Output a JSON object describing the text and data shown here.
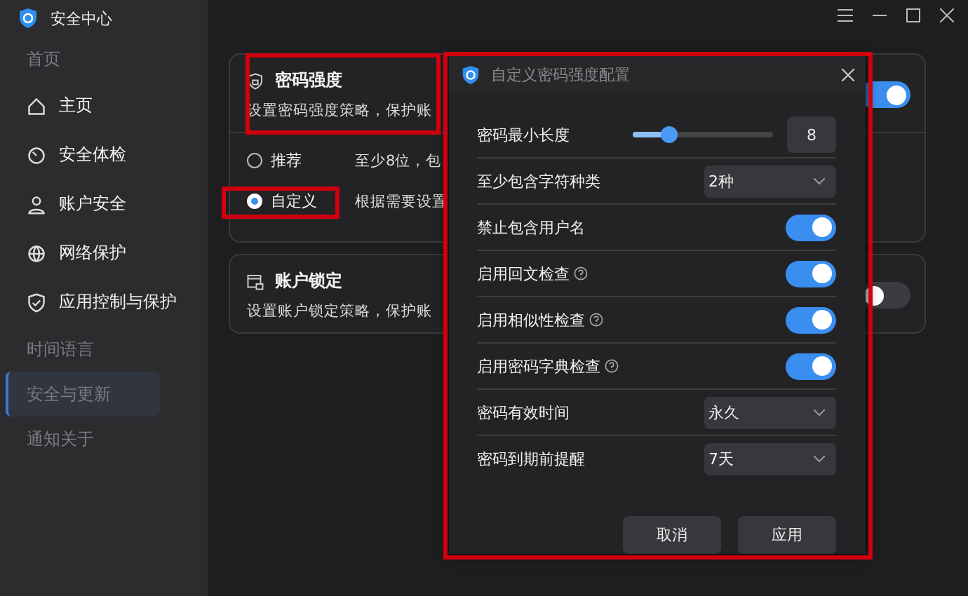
{
  "window": {
    "title": "安全中心"
  },
  "sidebar": {
    "items": [
      {
        "label": "首页",
        "kind": "ghost",
        "selected": false
      },
      {
        "label": "主页",
        "kind": "nav",
        "selected": false
      },
      {
        "label": "安全体检",
        "kind": "nav",
        "selected": false
      },
      {
        "label": "账户安全",
        "kind": "nav",
        "selected": false
      },
      {
        "label": "网络保护",
        "kind": "nav",
        "selected": false
      },
      {
        "label": "应用控制与保护",
        "kind": "nav",
        "selected": false
      },
      {
        "label": "时间语言",
        "kind": "ghost",
        "selected": false
      },
      {
        "label": "安全与更新",
        "kind": "ghost",
        "selected": true
      },
      {
        "label": "通知关于",
        "kind": "ghost",
        "selected": false
      }
    ]
  },
  "cards": [
    {
      "title": "密码强度",
      "description": "设置密码强度策略，保护账",
      "on": true,
      "options": [
        {
          "label": "推荐",
          "detail": "至少8位，包",
          "selected": false
        },
        {
          "label": "自定义",
          "detail": "根据需要设置",
          "selected": true
        }
      ]
    },
    {
      "title": "账户锁定",
      "description": "设置账户锁定策略，保护账",
      "on": false
    }
  ],
  "dialog": {
    "title": "自定义密码强度配置",
    "rows": [
      {
        "kind": "slider",
        "label": "密码最小长度",
        "level": 0.26,
        "value": "8"
      },
      {
        "kind": "select",
        "label": "至少包含字符种类",
        "value": "2种"
      },
      {
        "kind": "toggle",
        "label": "禁止包含用户名",
        "on": true,
        "help": false
      },
      {
        "kind": "toggle",
        "label": "启用回文检查",
        "on": true,
        "help": true
      },
      {
        "kind": "toggle",
        "label": "启用相似性检查",
        "on": true,
        "help": true
      },
      {
        "kind": "toggle",
        "label": "启用密码字典检查",
        "on": true,
        "help": true
      },
      {
        "kind": "select",
        "label": "密码有效时间",
        "value": "永久"
      },
      {
        "kind": "select",
        "label": "密码到期前提醒",
        "value": "7天"
      }
    ],
    "buttons": [
      "取消",
      "应用"
    ]
  }
}
